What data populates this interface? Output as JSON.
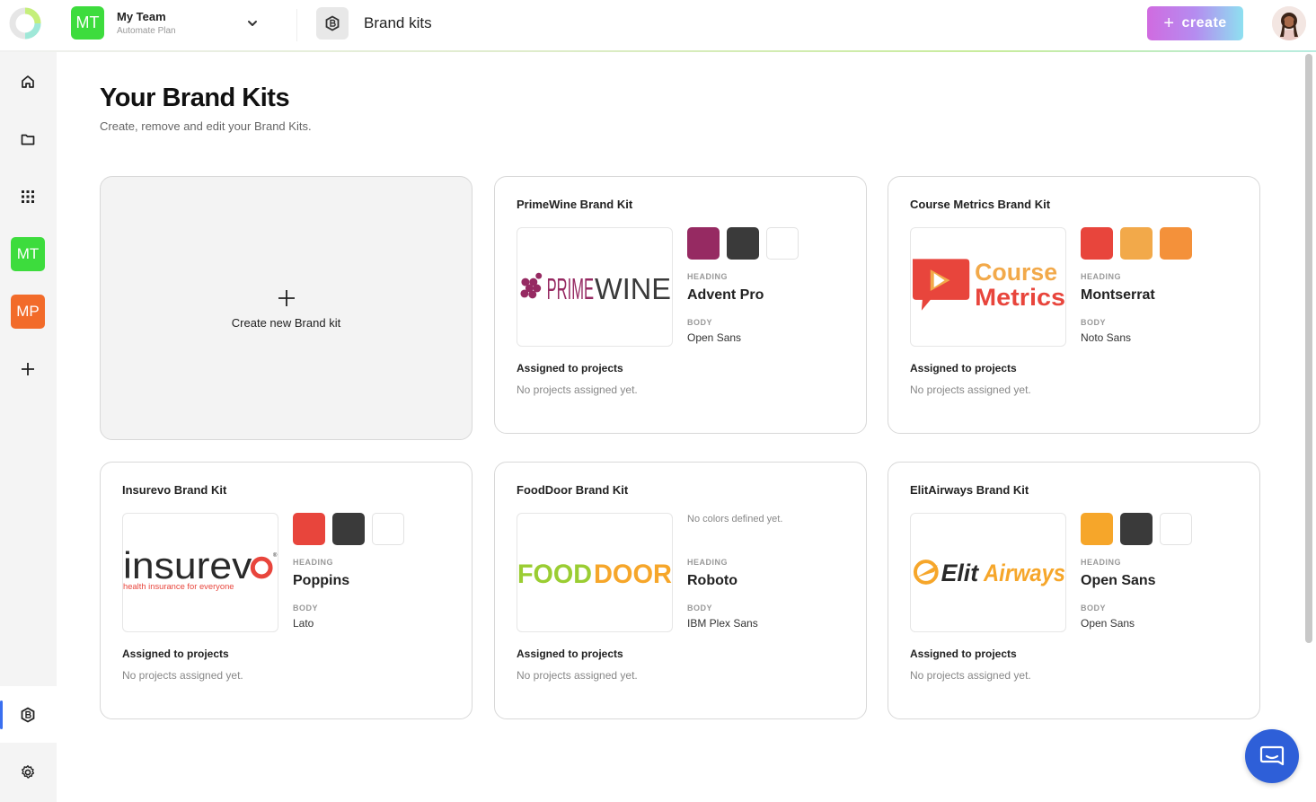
{
  "header": {
    "team_initials": "MT",
    "team_name": "My Team",
    "team_plan": "Automate Plan",
    "section_title": "Brand kits",
    "create_label": "create"
  },
  "sidebar": {
    "teams": [
      {
        "initials": "MT",
        "color": "#3ddc3d"
      },
      {
        "initials": "MP",
        "color": "#f26b2a"
      }
    ]
  },
  "page": {
    "title": "Your Brand Kits",
    "subtitle": "Create, remove and edit your Brand Kits.",
    "new_kit_label": "Create new Brand kit"
  },
  "labels": {
    "heading": "HEADING",
    "body": "BODY",
    "assigned": "Assigned to projects",
    "no_projects": "No projects assigned yet.",
    "no_colors": "No colors defined yet."
  },
  "kits": [
    {
      "name": "PrimeWine Brand Kit",
      "logo_text": "PRIMEWINE",
      "colors": [
        "#962a62",
        "#3a3a3a",
        "#ffffff"
      ],
      "heading_font": "Advent Pro",
      "body_font": "Open Sans"
    },
    {
      "name": "Course Metrics Brand Kit",
      "logo_text_1": "Course",
      "logo_text_2": "Metrics",
      "colors": [
        "#e8453c",
        "#f2a94a",
        "#f4913a"
      ],
      "heading_font": "Montserrat",
      "body_font": "Noto Sans"
    },
    {
      "name": "Insurevo Brand Kit",
      "logo_text": "insurevo",
      "logo_tagline": "health insurance for everyone",
      "colors": [
        "#e8453c",
        "#3a3a3a",
        "#ffffff"
      ],
      "heading_font": "Poppins",
      "body_font": "Lato"
    },
    {
      "name": "FoodDoor Brand Kit",
      "logo_text_1": "FOOD",
      "logo_text_2": "DOOR",
      "colors": [],
      "heading_font": "Roboto",
      "body_font": "IBM Plex Sans"
    },
    {
      "name": "ElitAirways Brand Kit",
      "logo_text_1": "Elit",
      "logo_text_2": "Airways",
      "colors": [
        "#f6a62a",
        "#3a3a3a",
        "#ffffff"
      ],
      "heading_font": "Open Sans",
      "body_font": "Open Sans"
    }
  ]
}
